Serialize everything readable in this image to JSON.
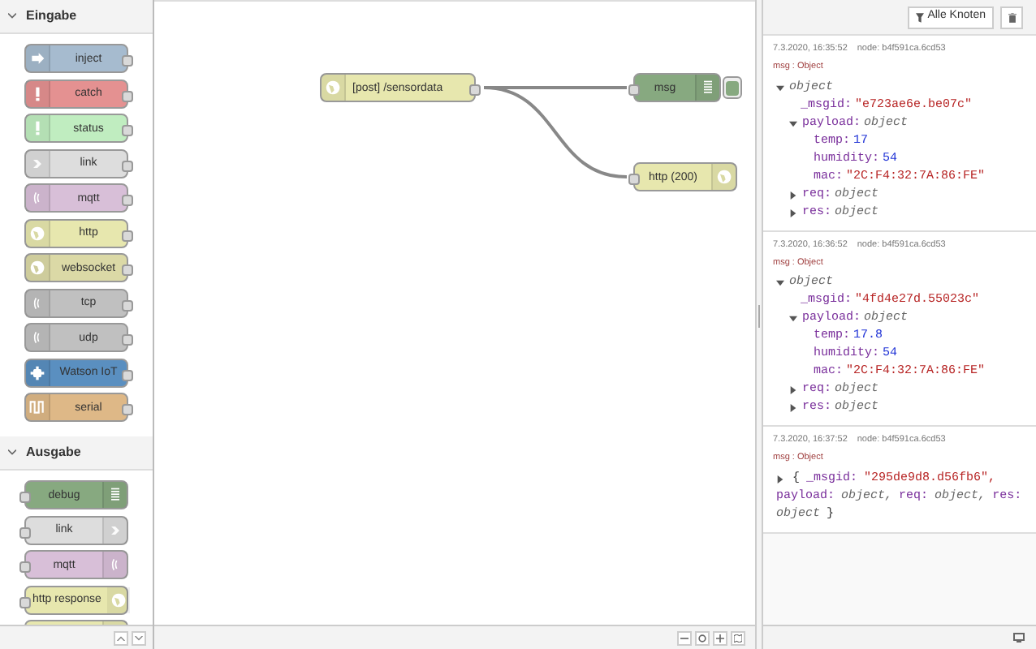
{
  "palette": {
    "categories": [
      {
        "title": "Eingabe",
        "expanded": true,
        "nodes": [
          {
            "label": "inject",
            "kind": "inject",
            "color": "#a6bbcf",
            "has_output": true
          },
          {
            "label": "catch",
            "kind": "catch",
            "color": "#e49191",
            "has_output": true
          },
          {
            "label": "status",
            "kind": "status",
            "color": "#c0edc0",
            "has_output": true
          },
          {
            "label": "link",
            "kind": "link",
            "color": "#dddddd",
            "has_output": true
          },
          {
            "label": "mqtt",
            "kind": "mqtt",
            "color": "#d8bfd8",
            "has_output": true
          },
          {
            "label": "http",
            "kind": "http",
            "color": "#e7e7ae",
            "has_output": true
          },
          {
            "label": "websocket",
            "kind": "http",
            "color": "#dbd9a6",
            "has_output": true
          },
          {
            "label": "tcp",
            "kind": "mqtt",
            "color": "#c0c0c0",
            "has_output": true
          },
          {
            "label": "udp",
            "kind": "mqtt",
            "color": "#c0c0c0",
            "has_output": true
          },
          {
            "label": "Watson IoT",
            "kind": "watson",
            "color": "#5a8fc0",
            "has_output": true
          },
          {
            "label": "serial",
            "kind": "serial",
            "color": "#deb887",
            "has_output": true
          }
        ]
      },
      {
        "title": "Ausgabe",
        "expanded": true,
        "nodes": [
          {
            "label": "debug",
            "kind": "debug",
            "color": "#87a980",
            "has_output": false
          },
          {
            "label": "link",
            "kind": "link",
            "color": "#dddddd",
            "has_output": false
          },
          {
            "label": "mqtt",
            "kind": "mqtt",
            "color": "#d8bfd8",
            "has_output": false
          },
          {
            "label": "http response",
            "kind": "http",
            "color": "#e7e7ae",
            "has_output": false
          },
          {
            "color": "#e7e7ae"
          }
        ]
      }
    ]
  },
  "flow": {
    "nodes": [
      {
        "label": "[post] /sensordata",
        "kind": "http",
        "color": "#e7e7ae",
        "has_output": true
      },
      {
        "label": "msg",
        "kind": "debug",
        "color": "#87a980",
        "has_output": false,
        "active": true
      },
      {
        "label": "http (200)",
        "kind": "http",
        "color": "#e7e7ae",
        "has_output": false
      }
    ]
  },
  "sidebar": {
    "filter_button": "Alle Knoten",
    "messages": [
      {
        "time": "7.3.2020, 16:35:52",
        "node": "node: b4f591ca.6cd53",
        "type": "msg : Object",
        "tree": {
          "value": "object",
          "kind": "type",
          "expanded": true,
          "children": [
            {
              "key": "_msgid:",
              "value": "\"e723ae6e.be07c\"",
              "kind": "string"
            },
            {
              "key": "payload:",
              "value": "object",
              "kind": "type",
              "expanded": true,
              "children": [
                {
                  "key": "temp:",
                  "value": "17",
                  "kind": "number"
                },
                {
                  "key": "humidity:",
                  "value": "54",
                  "kind": "number"
                },
                {
                  "key": "mac:",
                  "value": "\"2C:F4:32:7A:86:FE\"",
                  "kind": "string"
                }
              ]
            },
            {
              "key": "req:",
              "value": "object",
              "kind": "type",
              "expanded": false
            },
            {
              "key": "res:",
              "value": "object",
              "kind": "type",
              "expanded": false
            }
          ]
        }
      },
      {
        "time": "7.3.2020, 16:36:52",
        "node": "node: b4f591ca.6cd53",
        "type": "msg : Object",
        "tree": {
          "value": "object",
          "kind": "type",
          "expanded": true,
          "children": [
            {
              "key": "_msgid:",
              "value": "\"4fd4e27d.55023c\"",
              "kind": "string"
            },
            {
              "key": "payload:",
              "value": "object",
              "kind": "type",
              "expanded": true,
              "children": [
                {
                  "key": "temp:",
                  "value": "17.8",
                  "kind": "number"
                },
                {
                  "key": "humidity:",
                  "value": "54",
                  "kind": "number"
                },
                {
                  "key": "mac:",
                  "value": "\"2C:F4:32:7A:86:FE\"",
                  "kind": "string"
                }
              ]
            },
            {
              "key": "req:",
              "value": "object",
              "kind": "type",
              "expanded": false
            },
            {
              "key": "res:",
              "value": "object",
              "kind": "type",
              "expanded": false
            }
          ]
        }
      },
      {
        "time": "7.3.2020, 16:37:52",
        "node": "node: b4f591ca.6cd53",
        "type": "msg : Object",
        "summary": {
          "expanded": false,
          "parts": [
            {
              "kind": "punct",
              "text": "{"
            },
            {
              "kind": "key",
              "text": "_msgid:"
            },
            {
              "kind": "string",
              "text": "\"295de9d8.d56fb6\","
            },
            {
              "kind": "key",
              "text": "payload:"
            },
            {
              "kind": "type",
              "text": "object,"
            },
            {
              "kind": "key",
              "text": "req:"
            },
            {
              "kind": "type",
              "text": "object,"
            },
            {
              "kind": "key",
              "text": "res:"
            },
            {
              "kind": "type",
              "text": "object"
            },
            {
              "kind": "punct",
              "text": "}"
            }
          ]
        }
      }
    ]
  }
}
